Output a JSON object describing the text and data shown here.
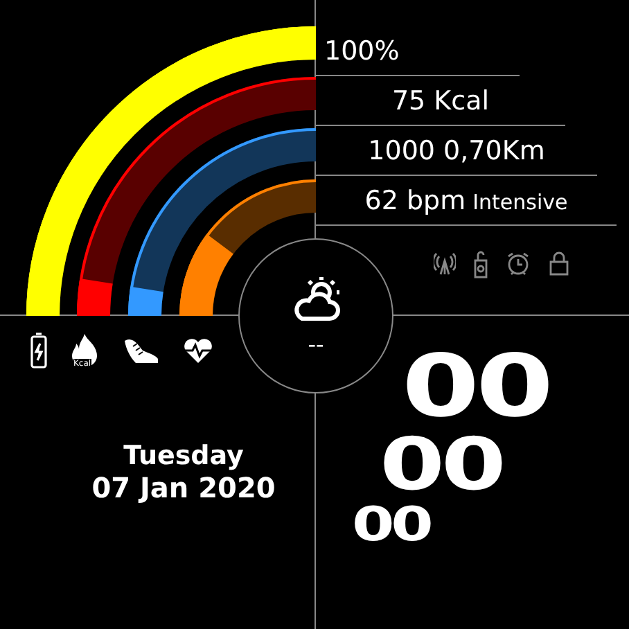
{
  "rings": [
    {
      "color": "#ffff00"
    },
    {
      "color": "#ff0000"
    },
    {
      "color": "#3399ff"
    },
    {
      "color": "#ff8000"
    }
  ],
  "stats": [
    {
      "value": "100%"
    },
    {
      "value": "75 Kcal"
    },
    {
      "value": "1000 0,70Km"
    },
    {
      "value": "62 bpm",
      "note": "Intensive"
    }
  ],
  "activity": {
    "flame_label": "Kcal"
  },
  "weather": {
    "temperature": "--"
  },
  "date": {
    "weekday": "Tuesday",
    "date": "07 Jan 2020"
  },
  "time": {
    "hours": "00",
    "minutes": "00",
    "seconds": "00"
  }
}
